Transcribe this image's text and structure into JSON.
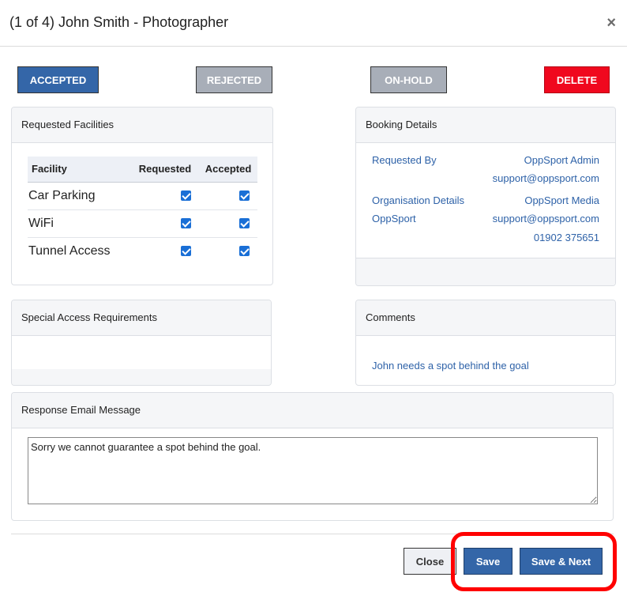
{
  "modal": {
    "title": "(1 of 4) John Smith - Photographer",
    "close_icon": "×"
  },
  "status_buttons": {
    "accepted": "ACCEPTED",
    "rejected": "REJECTED",
    "on_hold": "ON-HOLD",
    "delete": "DELETE"
  },
  "facilities": {
    "heading": "Requested Facilities",
    "columns": [
      "Facility",
      "Requested",
      "Accepted"
    ],
    "rows": [
      {
        "name": "Car Parking",
        "requested": true,
        "accepted": true
      },
      {
        "name": "WiFi",
        "requested": true,
        "accepted": true
      },
      {
        "name": "Tunnel Access",
        "requested": true,
        "accepted": true
      }
    ]
  },
  "booking": {
    "heading": "Booking Details",
    "requested_by_label": "Requested By",
    "requested_by_name": "OppSport Admin",
    "requested_by_email": "support@oppsport.com",
    "org_label": "Organisation Details",
    "org_sublabel": "OppSport",
    "org_name": "OppSport Media",
    "org_email": "support@oppsport.com",
    "org_phone": "01902 375651"
  },
  "special_access": {
    "heading": "Special Access Requirements"
  },
  "comments": {
    "heading": "Comments",
    "text": "John needs a spot behind the goal"
  },
  "response_email": {
    "heading": "Response Email Message",
    "value": "Sorry we cannot guarantee a spot behind the goal."
  },
  "footer": {
    "close": "Close",
    "save": "Save",
    "save_next": "Save & Next"
  },
  "colors": {
    "primary": "#3466a8",
    "inactive": "#a8aeb8",
    "danger": "#f0081e",
    "link": "#2e62a8",
    "highlight": "#ff0000"
  }
}
